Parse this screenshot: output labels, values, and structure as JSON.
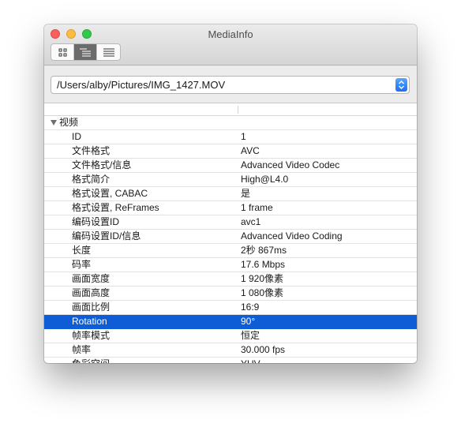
{
  "window": {
    "title": "MediaInfo"
  },
  "toolbar": {
    "view_buttons": [
      "grid-view-icon",
      "indented-list-icon",
      "plain-list-icon"
    ],
    "active_view": 1
  },
  "path_selector": {
    "value": "/Users/alby/Pictures/IMG_1427.MOV"
  },
  "table": {
    "section": "视频",
    "rows": [
      {
        "key": "ID",
        "value": "1"
      },
      {
        "key": "文件格式",
        "value": "AVC"
      },
      {
        "key": "文件格式/信息",
        "value": "Advanced Video Codec"
      },
      {
        "key": "格式简介",
        "value": "High@L4.0"
      },
      {
        "key": "格式设置, CABAC",
        "value": "是"
      },
      {
        "key": "格式设置, ReFrames",
        "value": "1 frame"
      },
      {
        "key": "编码设置ID",
        "value": "avc1"
      },
      {
        "key": "编码设置ID/信息",
        "value": "Advanced Video Coding"
      },
      {
        "key": "长度",
        "value": "2秒 867ms"
      },
      {
        "key": "码率",
        "value": "17.6 Mbps"
      },
      {
        "key": "画面宽度",
        "value": "1 920像素"
      },
      {
        "key": "画面高度",
        "value": "1 080像素"
      },
      {
        "key": "画面比例",
        "value": "16:9"
      },
      {
        "key": "Rotation",
        "value": "90°",
        "selected": true
      },
      {
        "key": "帧率模式",
        "value": "恒定"
      },
      {
        "key": "帧率",
        "value": "30.000 fps"
      },
      {
        "key": "色彩空间",
        "value": "YUV"
      }
    ]
  },
  "colors": {
    "selection": "#0f5dd6",
    "close": "#fc605c",
    "minimize": "#fdbc40",
    "maximize": "#34c84a",
    "stepper_accent": "#1b6ff5"
  }
}
